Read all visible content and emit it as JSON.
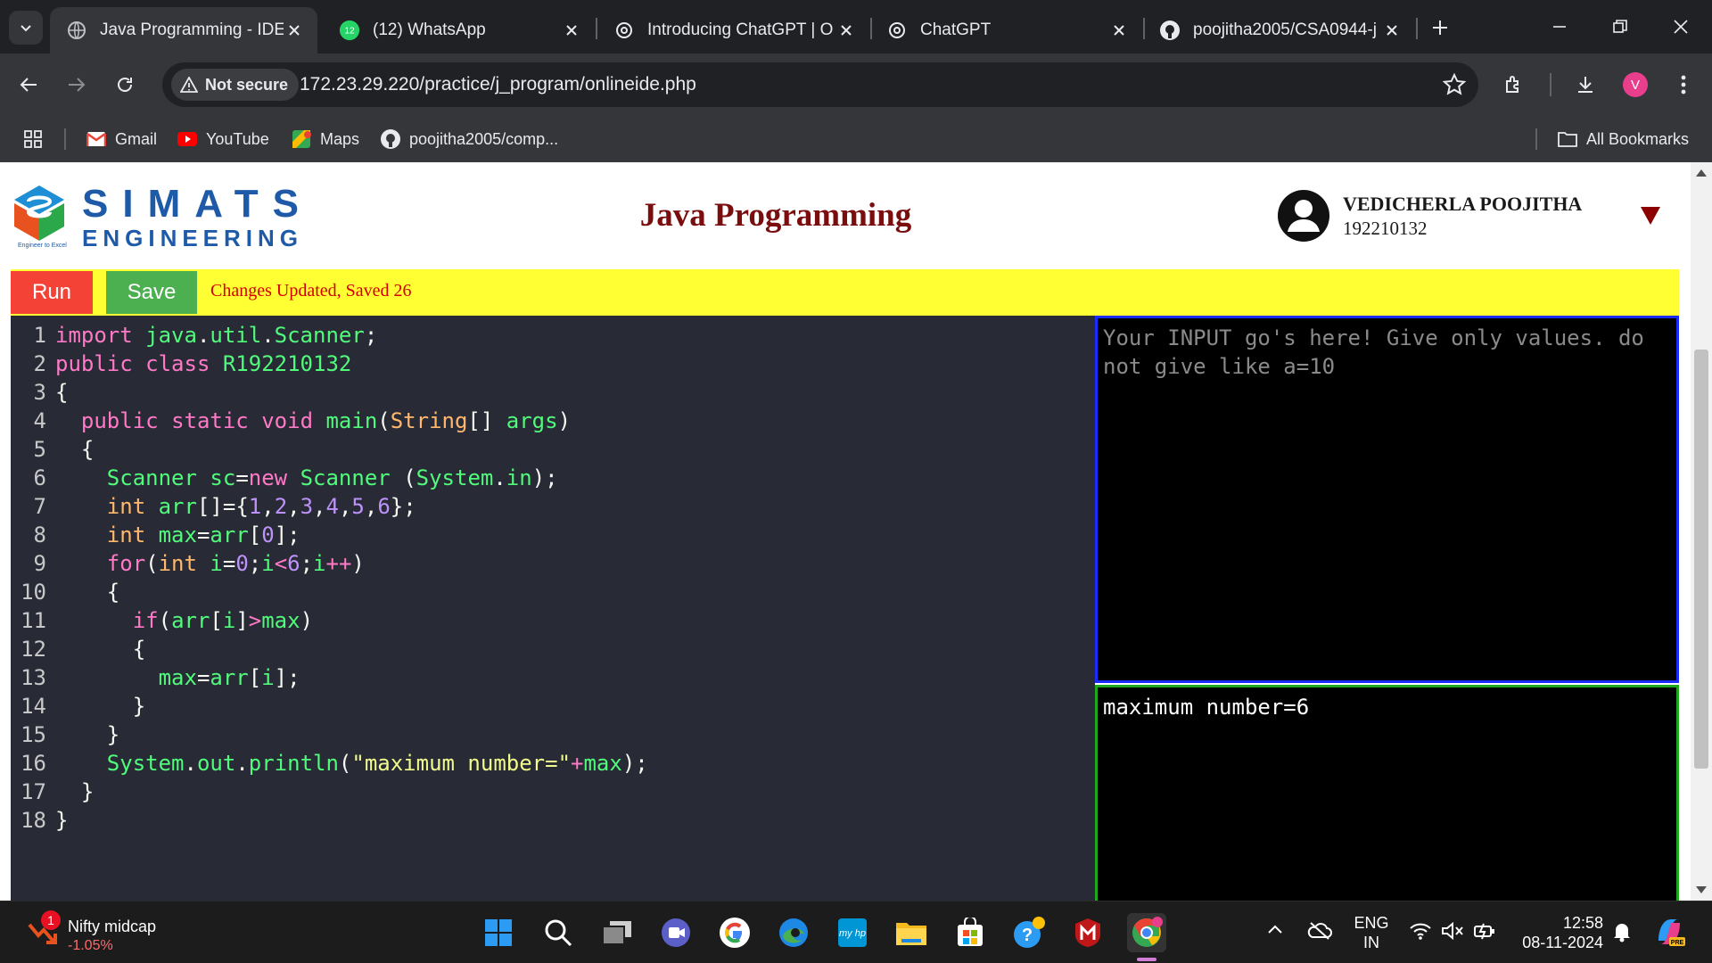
{
  "browser": {
    "tabs": [
      {
        "title": "Java Programming - IDE",
        "active": true,
        "icon": "globe-icon"
      },
      {
        "title": "(12) WhatsApp",
        "active": false,
        "icon": "whatsapp-icon",
        "badge": "12"
      },
      {
        "title": "Introducing ChatGPT | O",
        "active": false,
        "icon": "openai-icon"
      },
      {
        "title": "ChatGPT",
        "active": false,
        "icon": "openai-icon"
      },
      {
        "title": "poojitha2005/CSA0944-j",
        "active": false,
        "icon": "github-icon"
      }
    ],
    "security_label": "Not secure",
    "url": "172.23.29.220/practice/j_program/onlineide.php",
    "profile_initial": "V",
    "bookmarks": [
      {
        "label": "Gmail",
        "icon": "gmail-icon"
      },
      {
        "label": "YouTube",
        "icon": "youtube-icon"
      },
      {
        "label": "Maps",
        "icon": "maps-icon"
      },
      {
        "label": "poojitha2005/comp...",
        "icon": "github-icon"
      }
    ],
    "all_bookmarks_label": "All Bookmarks"
  },
  "page": {
    "logo": {
      "line1": "SIMATS",
      "line2": "ENGINEERING",
      "tagline": "Engineer to Excel"
    },
    "title": "Java Programming",
    "user": {
      "name": "VEDICHERLA POOJITHA",
      "id": "192210132"
    },
    "run_label": "Run",
    "save_label": "Save",
    "status": "Changes Updated, Saved 26",
    "input_placeholder": "Your INPUT go's here! Give only values. do not give like a=10",
    "output": "maximum number=6",
    "code_lines": [
      "import java.util.Scanner;",
      "public class R192210132",
      "{",
      "  public static void main(String[] args)",
      "  {",
      "    Scanner sc=new Scanner (System.in);",
      "    int arr[]={1,2,3,4,5,6};",
      "    int max=arr[0];",
      "    for(int i=0;i<6;i++)",
      "    {",
      "      if(arr[i]>max)",
      "      {",
      "        max=arr[i];",
      "      }",
      "    }",
      "    System.out.println(\"maximum number=\"+max);",
      "  }",
      "}"
    ]
  },
  "taskbar": {
    "widget": {
      "badge": "1",
      "title": "Nifty midcap",
      "value": "-1.05%"
    },
    "apps": [
      "start-icon",
      "search-icon",
      "task-view-icon",
      "teams-icon",
      "google-icon",
      "edge-icon",
      "myhp-icon",
      "file-explorer-icon",
      "store-icon",
      "help-icon",
      "mcafee-icon",
      "chrome-icon"
    ],
    "language": {
      "line1": "ENG",
      "line2": "IN"
    },
    "time": "12:58",
    "date": "08-11-2024"
  },
  "colors": {
    "run": "#f44336",
    "save": "#4caf50",
    "status_bar": "#ffff33",
    "status_text": "#d40000",
    "title": "#7a0d0d",
    "editor_bg": "#282a36",
    "input_border": "#1a2bff",
    "output_border": "#1ea81e"
  }
}
